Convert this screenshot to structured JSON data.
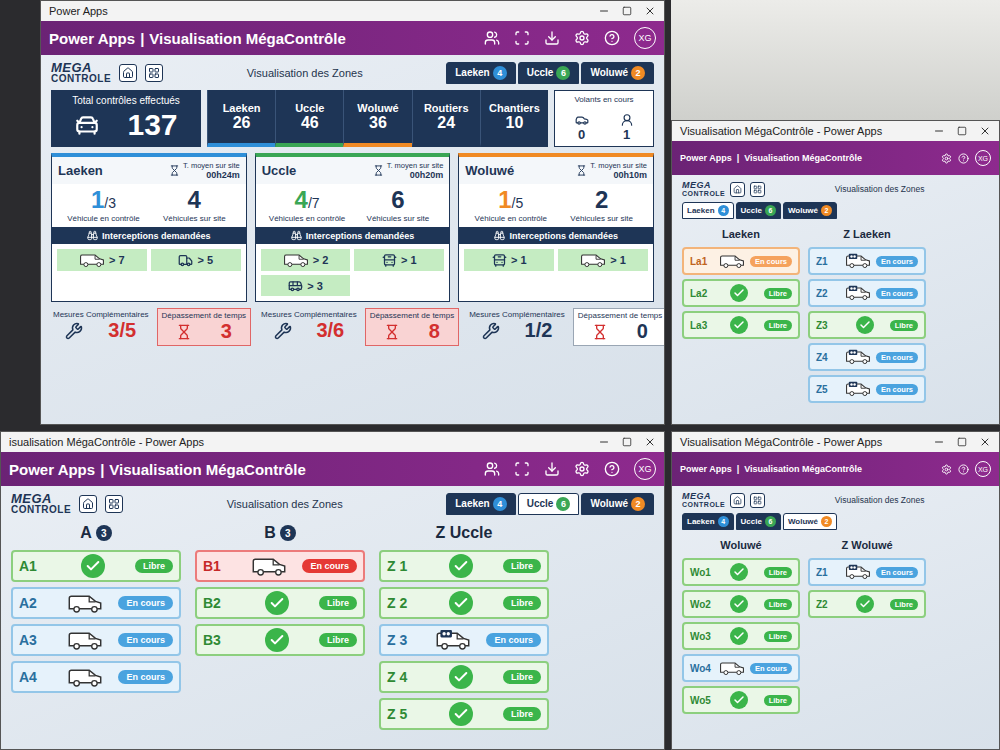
{
  "app_bar": {
    "brand": "Power Apps",
    "separator": "|",
    "title": "Visualisation MégaContrôle",
    "user": "XG"
  },
  "logo": {
    "top": "MEGA",
    "bottom": "CONTROLE"
  },
  "screen_title": "Visualisation des Zones",
  "overview": {
    "window_title": "Power Apps",
    "tabs": [
      {
        "label": "Laeken",
        "badge": "4",
        "color": "#2f8fd8",
        "selected": false
      },
      {
        "label": "Uccle",
        "badge": "6",
        "color": "#3aa655",
        "selected": false
      },
      {
        "label": "Woluwé",
        "badge": "2",
        "color": "#f08a24",
        "selected": false
      }
    ],
    "total": {
      "label": "Total contrôles effectués",
      "value": "137"
    },
    "zone_totals": [
      {
        "name": "Laeken",
        "value": "26",
        "color": "#2f8fd8"
      },
      {
        "name": "Uccle",
        "value": "46",
        "color": "#3aa655"
      },
      {
        "name": "Woluwé",
        "value": "36",
        "color": "#f08a24"
      },
      {
        "name": "Routiers",
        "value": "24"
      },
      {
        "name": "Chantiers",
        "value": "10"
      }
    ],
    "floating": {
      "label": "Volants en cours",
      "items": [
        {
          "kind": "car",
          "value": "0"
        },
        {
          "kind": "officer",
          "value": "1"
        }
      ]
    },
    "zones": [
      {
        "name": "Laeken",
        "color": "#2f8fd8",
        "avg_label": "T. moyen sur site",
        "avg": "00h24m",
        "in_control": "1",
        "capacity": "/3",
        "in_control_label": "Véhicule en contrôle",
        "on_site": "4",
        "on_site_label": "Véhicules sur site",
        "interceptions_label": "Interceptions demandées",
        "interceptions": [
          {
            "kind": "van",
            "value": "> 7"
          },
          {
            "kind": "truck",
            "value": "> 5"
          }
        ],
        "measures_label": "Mesures Complémentaires",
        "measures": "3/5",
        "measures_alert": true,
        "overtime_label": "Dépassement de temps",
        "overtime": "3",
        "overtime_alert": true
      },
      {
        "name": "Uccle",
        "color": "#3aa655",
        "avg_label": "T. moyen sur site",
        "avg": "00h20m",
        "in_control": "4",
        "capacity": "/7",
        "in_control_label": "Véhicules en contrôle",
        "on_site": "6",
        "on_site_label": "Véhicules sur site",
        "interceptions_label": "Interceptions demandées",
        "interceptions": [
          {
            "kind": "van",
            "value": "> 2"
          },
          {
            "kind": "bus",
            "value": "> 1"
          },
          {
            "kind": "coach",
            "value": "> 3"
          }
        ],
        "measures_label": "Mesures Complémentaires",
        "measures": "3/6",
        "measures_alert": true,
        "overtime_label": "Dépassement de temps",
        "overtime": "8",
        "overtime_alert": true
      },
      {
        "name": "Woluwé",
        "color": "#f08a24",
        "avg_label": "T. moyen sur site",
        "avg": "00h10m",
        "in_control": "1",
        "capacity": "/5",
        "in_control_label": "Véhicule en contrôle",
        "on_site": "2",
        "on_site_label": "Véhicules sur site",
        "interceptions_label": "Interceptions demandées",
        "interceptions": [
          {
            "kind": "bus",
            "value": "> 1"
          },
          {
            "kind": "van",
            "value": "> 1"
          }
        ],
        "measures_label": "Mesures Complémentaires",
        "measures": "1/2",
        "measures_alert": false,
        "overtime_label": "Dépassement de temps",
        "overtime": "0",
        "overtime_alert": false
      }
    ]
  },
  "laeken_view": {
    "window_title": "Visualisation MégaContrôle - Power Apps",
    "tabs": [
      {
        "label": "Laeken",
        "badge": "4",
        "color": "#2f8fd8",
        "selected": true
      },
      {
        "label": "Uccle",
        "badge": "6",
        "color": "#3aa655",
        "selected": false
      },
      {
        "label": "Woluwé",
        "badge": "2",
        "color": "#f08a24",
        "selected": false
      }
    ],
    "columns": [
      {
        "title": "Laeken",
        "slots": [
          {
            "label": "La1",
            "state": "warning",
            "vehicle": "van",
            "status": "En cours"
          },
          {
            "label": "La2",
            "state": "free",
            "vehicle": "none",
            "status": "Libre"
          },
          {
            "label": "La3",
            "state": "free",
            "vehicle": "none",
            "status": "Libre"
          }
        ]
      },
      {
        "title": "Z Laeken",
        "slots": [
          {
            "label": "Z1",
            "state": "busy",
            "vehicle": "intercept",
            "status": "En cours"
          },
          {
            "label": "Z2",
            "state": "busy",
            "vehicle": "intercept",
            "status": "En cours"
          },
          {
            "label": "Z3",
            "state": "free",
            "vehicle": "none",
            "status": "Libre"
          },
          {
            "label": "Z4",
            "state": "busy",
            "vehicle": "intercept",
            "status": "En cours"
          },
          {
            "label": "Z5",
            "state": "busy",
            "vehicle": "intercept",
            "status": "En cours"
          }
        ]
      }
    ]
  },
  "uccle_view": {
    "window_title": "isualisation MégaContrôle - Power Apps",
    "tabs": [
      {
        "label": "Laeken",
        "badge": "4",
        "color": "#2f8fd8",
        "selected": false
      },
      {
        "label": "Uccle",
        "badge": "6",
        "color": "#3aa655",
        "selected": true
      },
      {
        "label": "Woluwé",
        "badge": "2",
        "color": "#f08a24",
        "selected": false
      }
    ],
    "columns": [
      {
        "title": "A",
        "badge": "3",
        "slots": [
          {
            "label": "A1",
            "state": "free",
            "vehicle": "none",
            "status": "Libre"
          },
          {
            "label": "A2",
            "state": "busy",
            "vehicle": "van",
            "status": "En cours"
          },
          {
            "label": "A3",
            "state": "busy",
            "vehicle": "van",
            "status": "En cours"
          },
          {
            "label": "A4",
            "state": "busy",
            "vehicle": "van",
            "status": "En cours"
          }
        ]
      },
      {
        "title": "B",
        "badge": "3",
        "slots": [
          {
            "label": "B1",
            "state": "late",
            "vehicle": "van",
            "status": "En cours"
          },
          {
            "label": "B2",
            "state": "free",
            "vehicle": "none",
            "status": "Libre"
          },
          {
            "label": "B3",
            "state": "free",
            "vehicle": "none",
            "status": "Libre"
          }
        ]
      },
      {
        "title": "Z Uccle",
        "slots": [
          {
            "label": "Z 1",
            "state": "free",
            "vehicle": "none",
            "status": "Libre"
          },
          {
            "label": "Z 2",
            "state": "free",
            "vehicle": "none",
            "status": "Libre"
          },
          {
            "label": "Z 3",
            "state": "busy",
            "vehicle": "intercept",
            "status": "En cours"
          },
          {
            "label": "Z 4",
            "state": "free",
            "vehicle": "none",
            "status": "Libre"
          },
          {
            "label": "Z 5",
            "state": "free",
            "vehicle": "none",
            "status": "Libre"
          }
        ]
      }
    ]
  },
  "woluwe_view": {
    "window_title": "Visualisation MégaContrôle - Power Apps",
    "tabs": [
      {
        "label": "Laeken",
        "badge": "4",
        "color": "#2f8fd8",
        "selected": false
      },
      {
        "label": "Uccle",
        "badge": "6",
        "color": "#3aa655",
        "selected": false
      },
      {
        "label": "Woluwé",
        "badge": "2",
        "color": "#f08a24",
        "selected": true
      }
    ],
    "columns": [
      {
        "title": "Woluwé",
        "slots": [
          {
            "label": "Wo1",
            "state": "free",
            "vehicle": "none",
            "status": "Libre"
          },
          {
            "label": "Wo2",
            "state": "free",
            "vehicle": "none",
            "status": "Libre"
          },
          {
            "label": "Wo3",
            "state": "free",
            "vehicle": "none",
            "status": "Libre"
          },
          {
            "label": "Wo4",
            "state": "busy",
            "vehicle": "van",
            "status": "En cours"
          },
          {
            "label": "Wo5",
            "state": "free",
            "vehicle": "none",
            "status": "Libre"
          }
        ]
      },
      {
        "title": "Z Woluwé",
        "slots": [
          {
            "label": "Z1",
            "state": "busy",
            "vehicle": "intercept",
            "status": "En cours"
          },
          {
            "label": "Z2",
            "state": "free",
            "vehicle": "none",
            "status": "Libre"
          }
        ]
      }
    ]
  }
}
